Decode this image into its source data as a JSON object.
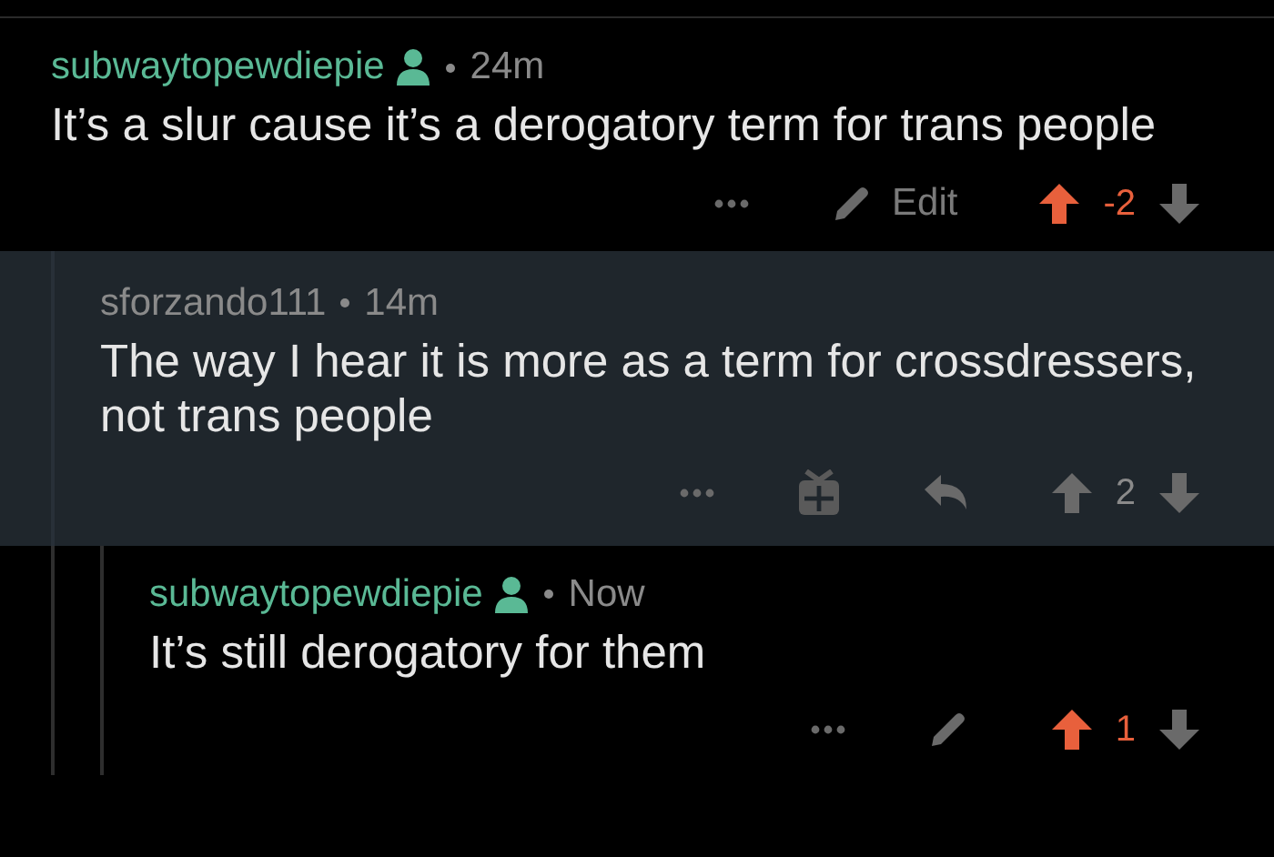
{
  "comments": [
    {
      "author": "subwaytopewdiepie",
      "op": true,
      "time": "24m",
      "highlighted": false,
      "body": "It’s a slur cause it’s a derogatory term for trans people",
      "actions": [
        {
          "kind": "more"
        },
        {
          "kind": "edit",
          "label": "Edit"
        }
      ],
      "upvoted": true,
      "score": "-2",
      "children": [
        {
          "author": "sforzando111",
          "op": false,
          "time": "14m",
          "highlighted": true,
          "body": "The way I hear it is more as a term for crossdressers, not trans people",
          "actions": [
            {
              "kind": "more"
            },
            {
              "kind": "gift"
            },
            {
              "kind": "reply"
            }
          ],
          "upvoted": false,
          "score": "2",
          "children": [
            {
              "author": "subwaytopewdiepie",
              "op": true,
              "time": "Now",
              "highlighted": false,
              "body": "It’s still derogatory for them",
              "actions": [
                {
                  "kind": "more"
                },
                {
                  "kind": "edit"
                }
              ],
              "upvoted": true,
              "score": "1"
            }
          ]
        }
      ]
    }
  ]
}
